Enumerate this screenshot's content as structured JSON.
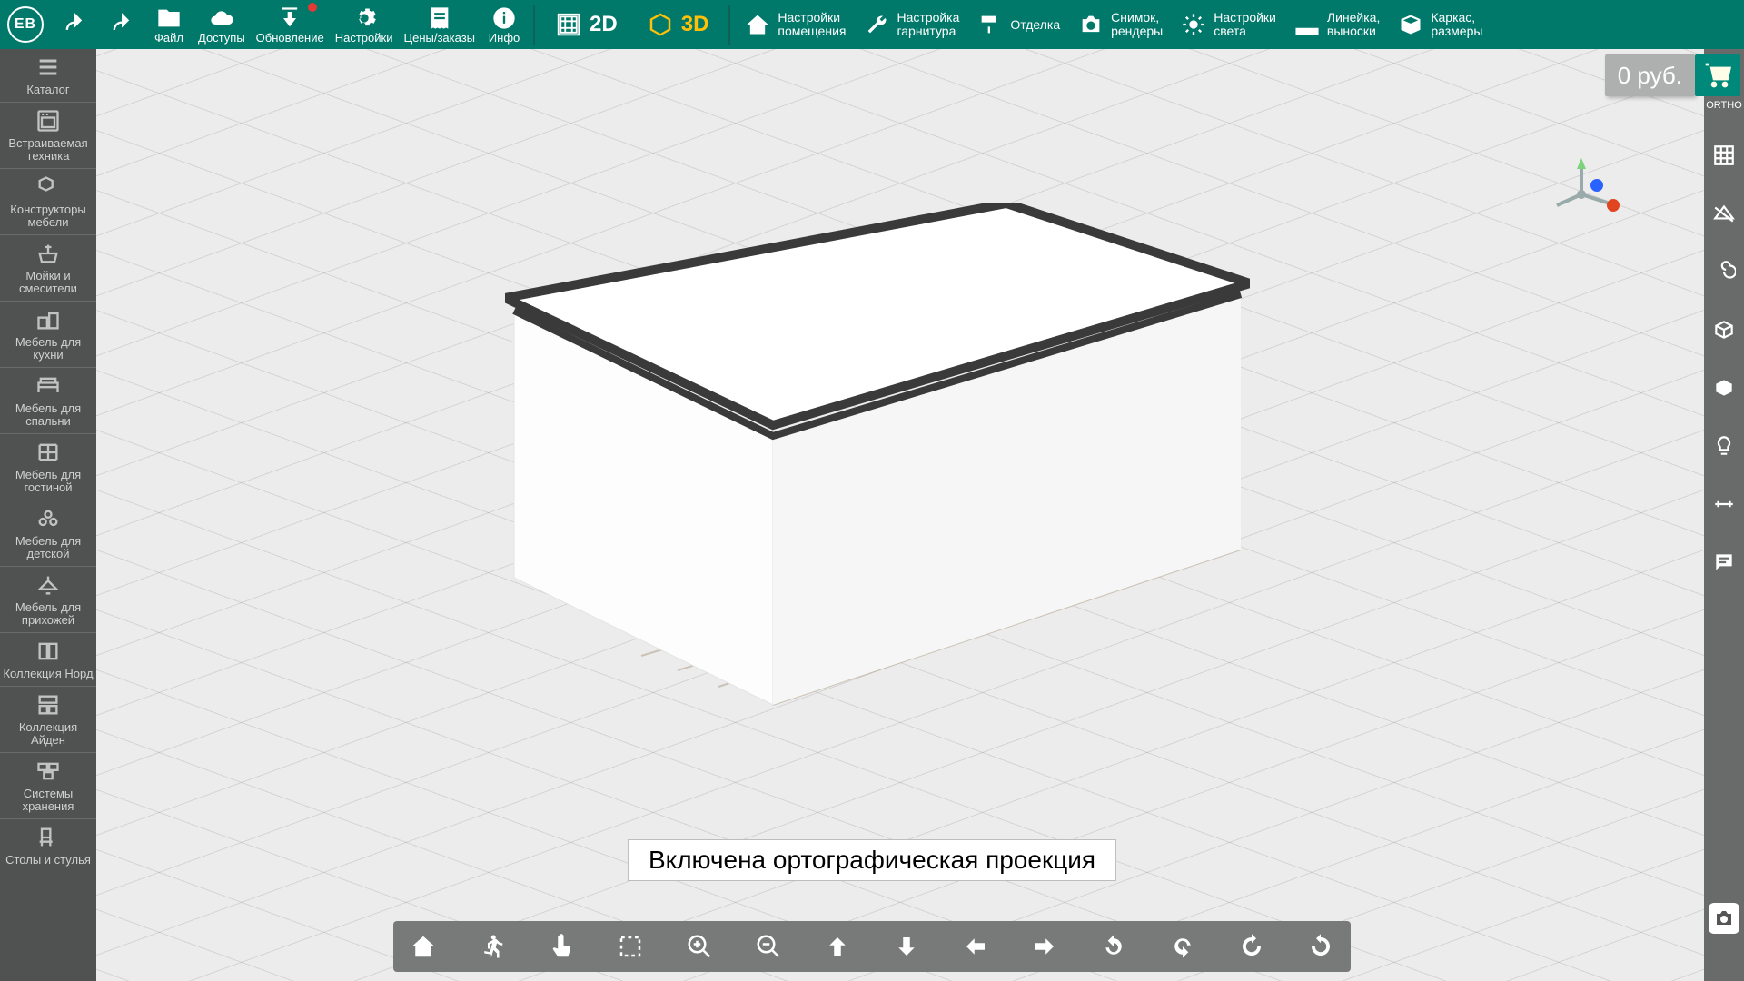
{
  "logo": "EB",
  "topbar": {
    "file": "Файл",
    "access": "Доступы",
    "update": "Обновление",
    "settings": "Настройки",
    "prices": "Цены/заказы",
    "info": "Инфо",
    "mode2d": "2D",
    "mode3d": "3D",
    "room": "Настройки\nпомещения",
    "furniture": "Настройка\nгарнитура",
    "finish": "Отделка",
    "snapshot": "Снимок,\nрендеры",
    "light": "Настройки\nсвета",
    "ruler": "Линейка,\nвыноски",
    "frame": "Каркас,\nразмеры"
  },
  "left_sidebar": [
    "Каталог",
    "Встраиваемая техника",
    "Конструкторы мебели",
    "Мойки и смесители",
    "Мебель для кухни",
    "Мебель для спальни",
    "Мебель для гостиной",
    "Мебель для детской",
    "Мебель для прихожей",
    "Коллекция Норд",
    "Коллекция Айден",
    "Системы хранения",
    "Столы и стулья"
  ],
  "right_sidebar": {
    "ortho": "ORTHO"
  },
  "price": "0 руб.",
  "toast": "Включена ортографическая проекция"
}
